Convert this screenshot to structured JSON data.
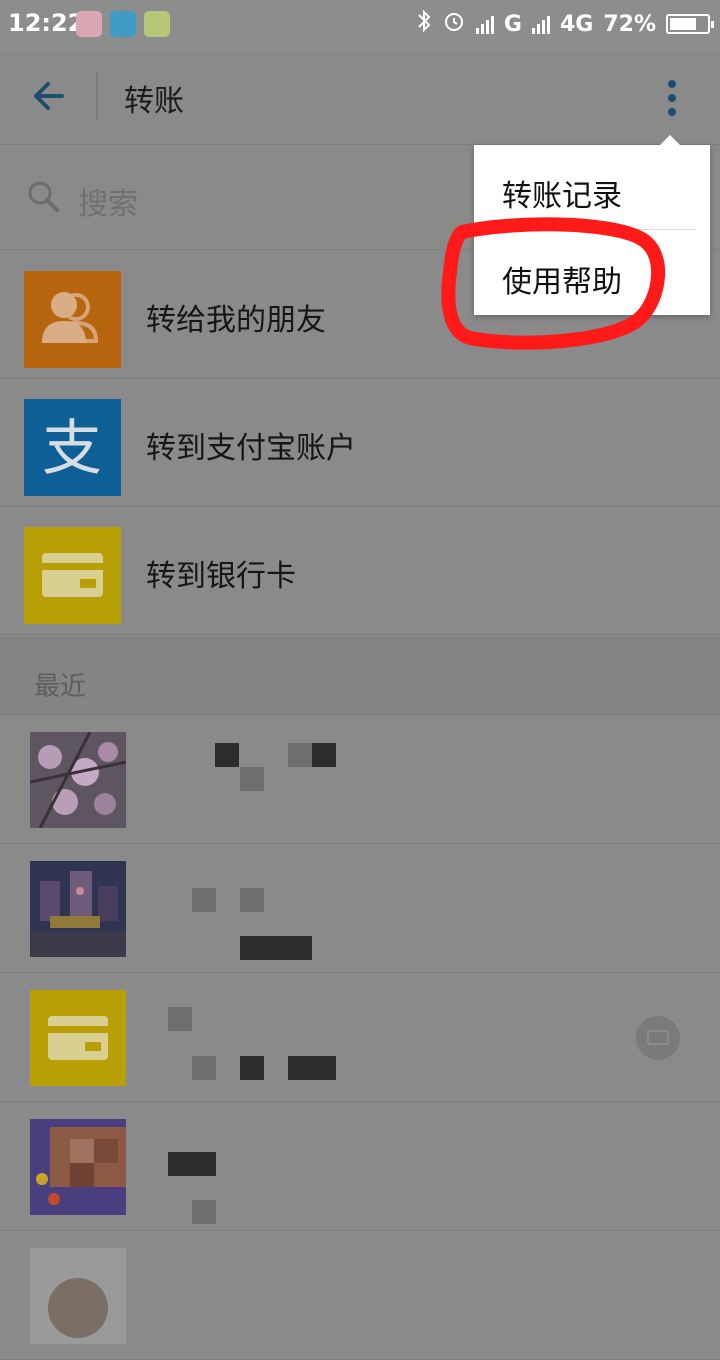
{
  "status_bar": {
    "time": "12:22",
    "network_labels": [
      "G",
      "4G"
    ],
    "battery": "72%",
    "battery_level": 0.72
  },
  "nav": {
    "title": "转账",
    "back_icon": "back-arrow-icon",
    "more_icon": "more-vertical-icon"
  },
  "search": {
    "placeholder": "搜索",
    "icon": "search-icon"
  },
  "transfer_options": [
    {
      "label": "转给我的朋友",
      "icon": "friends-icon",
      "color": "#b8650f"
    },
    {
      "label": "转到支付宝账户",
      "icon": "alipay-icon",
      "color": "#0d5f95"
    },
    {
      "label": "转到银行卡",
      "icon": "bank-card-icon",
      "color": "#b89f06"
    }
  ],
  "recent": {
    "title": "最近"
  },
  "menu": {
    "items": [
      "转账记录",
      "使用帮助"
    ]
  },
  "colors": {
    "accent": "#1c4f6e",
    "highlight": "#ff1a1a"
  }
}
